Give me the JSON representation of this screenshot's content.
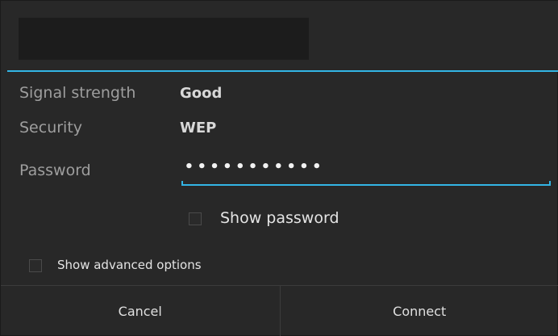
{
  "dialog": {
    "fields": {
      "signal_strength": {
        "label": "Signal strength",
        "value": "Good"
      },
      "security": {
        "label": "Security",
        "value": "WEP"
      },
      "password": {
        "label": "Password",
        "masked_value": "•••••••••••"
      }
    },
    "show_password": {
      "label": "Show password",
      "checked": false
    },
    "show_advanced": {
      "label": "Show advanced options",
      "checked": false
    },
    "buttons": {
      "cancel": "Cancel",
      "connect": "Connect"
    }
  },
  "colors": {
    "accent": "#33b5e5",
    "background": "#282828"
  }
}
